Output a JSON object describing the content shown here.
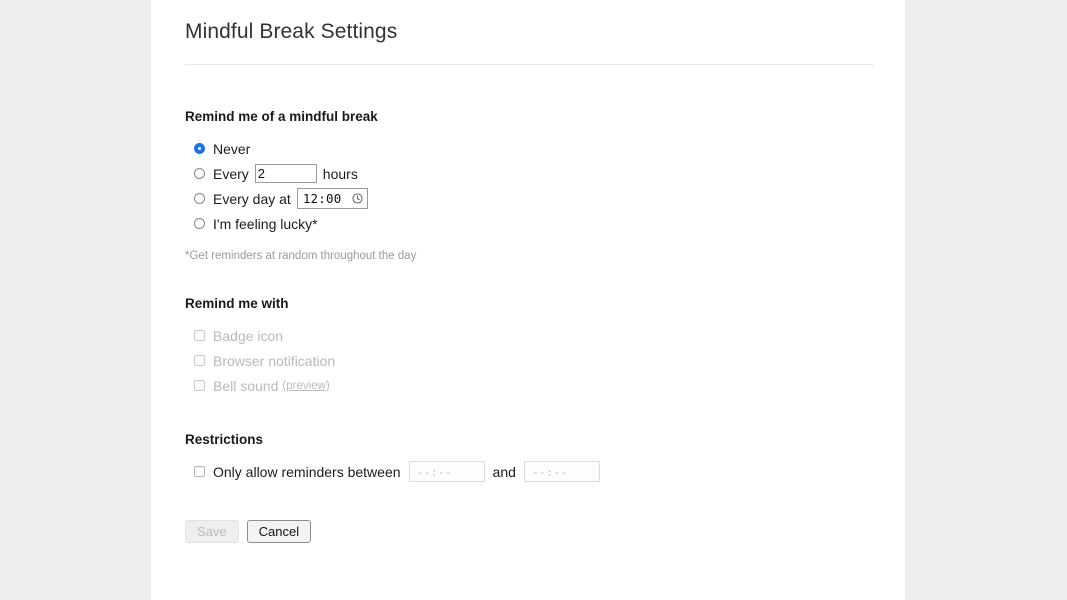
{
  "page": {
    "title": "Mindful Break Settings"
  },
  "reminder_section": {
    "heading": "Remind me of a mindful break",
    "options": [
      {
        "label": "Never",
        "selected": true
      },
      {
        "label": "Every",
        "selected": false,
        "value": "2",
        "suffix": "hours"
      },
      {
        "label": "Every day at",
        "selected": false,
        "time_value": "12:00",
        "icon": "clock-icon"
      },
      {
        "label": "I'm feeling lucky*",
        "selected": false
      }
    ],
    "footnote": "*Get reminders at random throughout the day"
  },
  "remind_with_section": {
    "heading": "Remind me with",
    "options": [
      {
        "label": "Badge icon",
        "checked": false,
        "disabled": true
      },
      {
        "label": "Browser notification",
        "checked": false,
        "disabled": true
      },
      {
        "label": "Bell sound",
        "checked": false,
        "disabled": true,
        "link": "(preview)"
      }
    ]
  },
  "restrictions_section": {
    "heading": "Restrictions",
    "option": {
      "label": "Only allow reminders between",
      "checked": false,
      "conjunction": "and",
      "start_placeholder": "--:--",
      "end_placeholder": "--:--"
    }
  },
  "footer": {
    "save_label": "Save",
    "save_disabled": true,
    "cancel_label": "Cancel"
  },
  "colors": {
    "accent": "#1a73e8",
    "page_background": "#eeeeee",
    "panel_background": "#ffffff",
    "text": "#1c1c1c",
    "muted_text": "#b9b9b9"
  }
}
